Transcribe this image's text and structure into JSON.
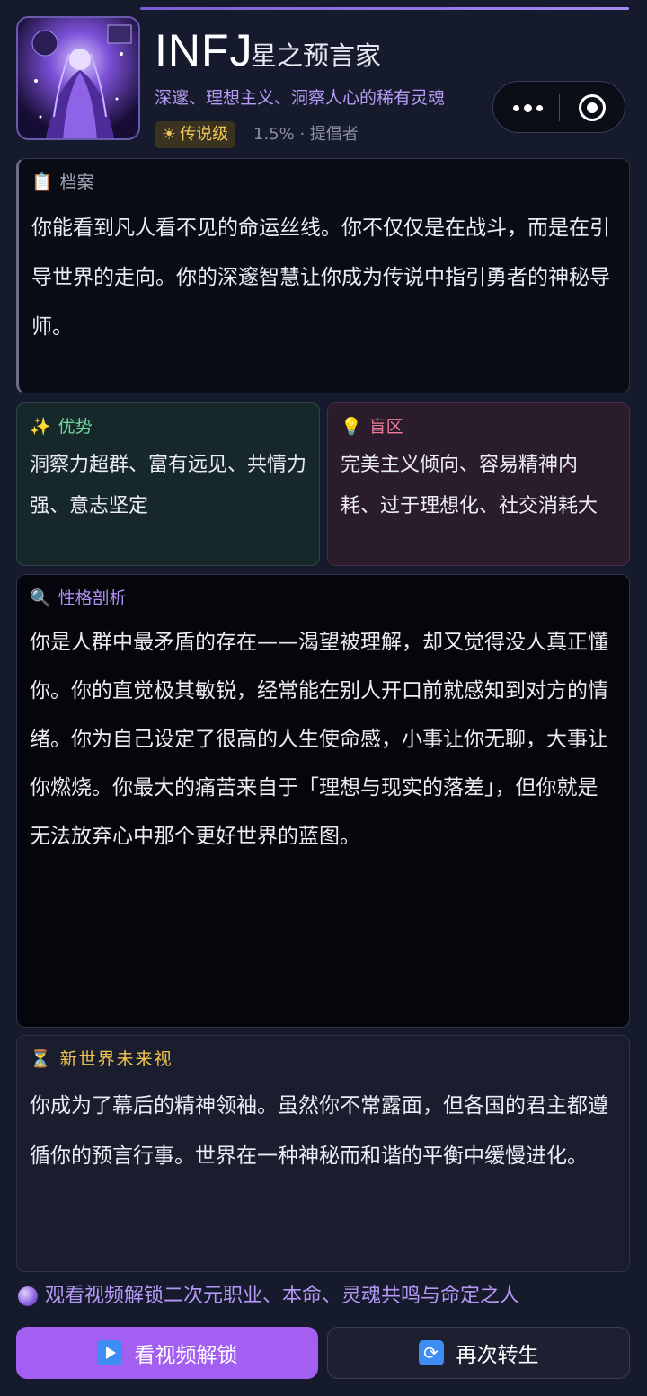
{
  "header": {
    "type_code": "INFJ",
    "type_name": "星之预言家",
    "tagline": "深邃、理想主义、洞察人心的稀有灵魂",
    "badge_label": "传说级",
    "meta": "1.5% · 提倡者"
  },
  "archive": {
    "title": "档案",
    "text": "你能看到凡人看不见的命运丝线。你不仅仅是在战斗，而是在引导世界的走向。你的深邃智慧让你成为传说中指引勇者的神秘导师。"
  },
  "strengths": {
    "title": "优势",
    "text": "洞察力超群、富有远见、共情力强、意志坚定"
  },
  "blind_spots": {
    "title": "盲区",
    "text": "完美主义倾向、容易精神内耗、过于理想化、社交消耗大"
  },
  "analysis": {
    "title": "性格剖析",
    "text": "你是人群中最矛盾的存在——渴望被理解，却又觉得没人真正懂你。你的直觉极其敏锐，经常能在别人开口前就感知到对方的情绪。你为自己设定了很高的人生使命感，小事让你无聊，大事让你燃烧。你最大的痛苦来自于「理想与现实的落差」，但你就是无法放弃心中那个更好世界的蓝图。"
  },
  "future": {
    "title": "新世界未来视",
    "text": "你成为了幕后的精神领袖。虽然你不常露面，但各国的君主都遵循你的预言行事。世界在一种神秘而和谐的平衡中缓慢进化。"
  },
  "unlock_hint": "观看视频解锁二次元职业、本命、灵魂共鸣与命定之人",
  "buttons": {
    "watch": "看视频解锁",
    "rebirth": "再次转生"
  },
  "icons": {
    "archive": "clipboard-icon",
    "strengths": "sparkles-icon",
    "blind_spots": "lightbulb-icon",
    "analysis": "magnifier-icon",
    "future": "hourglass-icon",
    "badge": "sun-icon",
    "hint": "crystal-ball-icon"
  },
  "colors": {
    "accent": "#a35ef2",
    "strength": "#6fd8a0",
    "blind_spot": "#f07c9c",
    "future": "#f0c44e",
    "badge": "#f2c65a"
  }
}
